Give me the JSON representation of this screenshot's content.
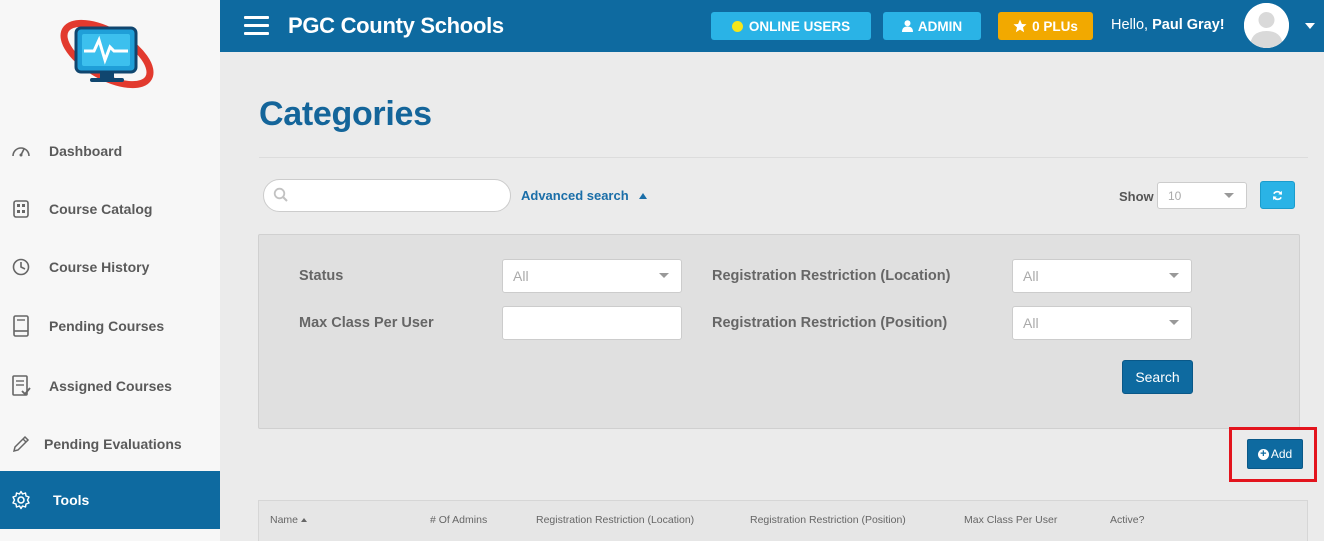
{
  "header": {
    "title": "PGC County Schools",
    "online_users": "ONLINE USERS",
    "admin": "ADMIN",
    "plus": "0 PLUs",
    "greeting": "Hello,",
    "user_name": "Paul Gray!"
  },
  "sidebar": {
    "items": [
      {
        "label": "Dashboard",
        "icon": "gauge-icon"
      },
      {
        "label": "Course Catalog",
        "icon": "catalog-icon"
      },
      {
        "label": "Course History",
        "icon": "history-icon"
      },
      {
        "label": "Pending Courses",
        "icon": "book-icon"
      },
      {
        "label": "Assigned Courses",
        "icon": "assigned-icon"
      },
      {
        "label": "Pending Evaluations",
        "icon": "pencil-icon"
      },
      {
        "label": "Tools",
        "icon": "gear-icon",
        "active": true
      }
    ]
  },
  "main": {
    "page_title": "Categories",
    "search_placeholder": "",
    "advanced_search": "Advanced search",
    "show_label": "Show",
    "show_value": "10",
    "filters": {
      "status_label": "Status",
      "status_value": "All",
      "max_class_label": "Max Class Per User",
      "max_class_value": "",
      "reg_location_label": "Registration Restriction (Location)",
      "reg_location_value": "All",
      "reg_position_label": "Registration Restriction (Position)",
      "reg_position_value": "All",
      "search_button": "Search"
    },
    "add_button": "Add",
    "table_columns": [
      "Name",
      "# Of Admins",
      "Registration Restriction (Location)",
      "Registration Restriction (Position)",
      "Max Class Per User",
      "Active?"
    ]
  },
  "colors": {
    "brand": "#0e6aa0",
    "accent_cyan": "#2ab3e6",
    "accent_gold": "#f2a900",
    "title_blue": "#14659a",
    "highlight_red": "#e3141d"
  }
}
